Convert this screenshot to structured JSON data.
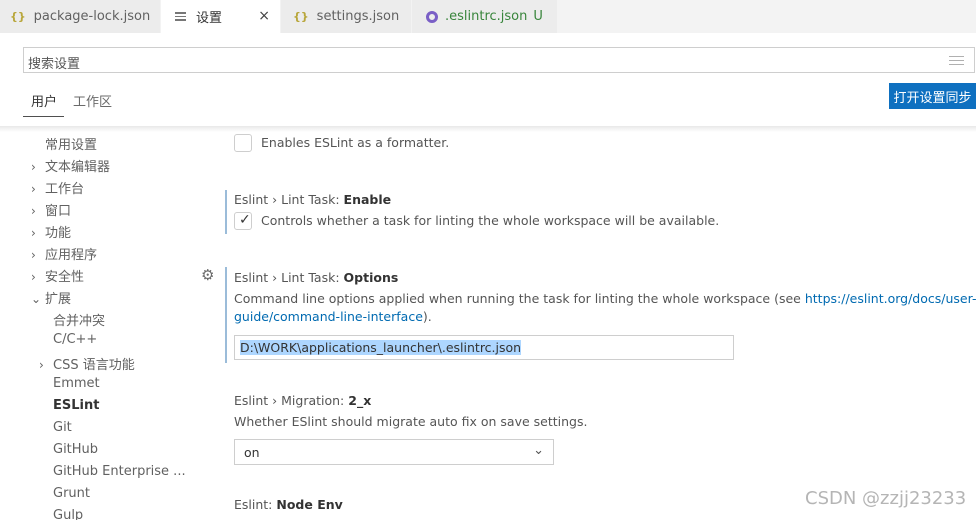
{
  "tabs": [
    {
      "label": "package-lock.json",
      "icon": "json-braces-icon"
    },
    {
      "label": "设置",
      "icon": "settings-lines-icon",
      "close": "×"
    },
    {
      "label": "settings.json",
      "icon": "json-braces-icon"
    },
    {
      "label": ".eslintrc.json",
      "icon": "eslint-icon",
      "status": "U"
    }
  ],
  "search": {
    "placeholder": "搜索设置"
  },
  "scope": {
    "user": "用户",
    "workspace": "工作区",
    "sync": "打开设置同步"
  },
  "toc": [
    {
      "label": "常用设置",
      "chev": ""
    },
    {
      "label": "文本编辑器",
      "chev": "›"
    },
    {
      "label": "工作台",
      "chev": "›"
    },
    {
      "label": "窗口",
      "chev": "›"
    },
    {
      "label": "功能",
      "chev": "›"
    },
    {
      "label": "应用程序",
      "chev": "›"
    },
    {
      "label": "安全性",
      "chev": "›"
    },
    {
      "label": "扩展",
      "chev": "⌄"
    },
    {
      "label": "合并冲突",
      "chev": ""
    },
    {
      "label": "C/C++",
      "chev": ""
    },
    {
      "label": "CSS 语言功能",
      "chev": "›"
    },
    {
      "label": "Emmet",
      "chev": ""
    },
    {
      "label": "ESLint",
      "chev": ""
    },
    {
      "label": "Git",
      "chev": ""
    },
    {
      "label": "GitHub",
      "chev": ""
    },
    {
      "label": "GitHub Enterprise ...",
      "chev": ""
    },
    {
      "label": "Grunt",
      "chev": ""
    },
    {
      "label": "Gulp",
      "chev": ""
    }
  ],
  "settings": {
    "formatter": {
      "desc": "Enables ESLint as a formatter.",
      "checked": false
    },
    "lintTaskEnable": {
      "category": "Eslint › Lint Task: ",
      "key": "Enable",
      "desc": "Controls whether a task for linting the whole workspace will be available.",
      "checked": true,
      "check_glyph": "✓"
    },
    "lintTaskOptions": {
      "category": "Eslint › Lint Task: ",
      "key": "Options",
      "desc1": "Command line options applied when running the task for linting the whole workspace (see ",
      "link1": "https://eslint.org/docs/user-",
      "link2": "guide/command-line-interface",
      "desc_end": ").",
      "value": "D:\\WORK\\applications_launcher\\.eslintrc.json"
    },
    "migration": {
      "category": "Eslint › Migration: ",
      "key": "2_x",
      "desc": "Whether ESlint should migrate auto fix on save settings.",
      "value": "on",
      "arrow": "⌄"
    },
    "nodeEnv": {
      "category": "Eslint: ",
      "key": "Node Env"
    }
  },
  "gear": "⚙",
  "watermark": "CSDN @zzjj23233",
  "colors": {
    "accent": "#0e70c0",
    "link": "#006ab1",
    "git_untracked": "#38853b"
  }
}
